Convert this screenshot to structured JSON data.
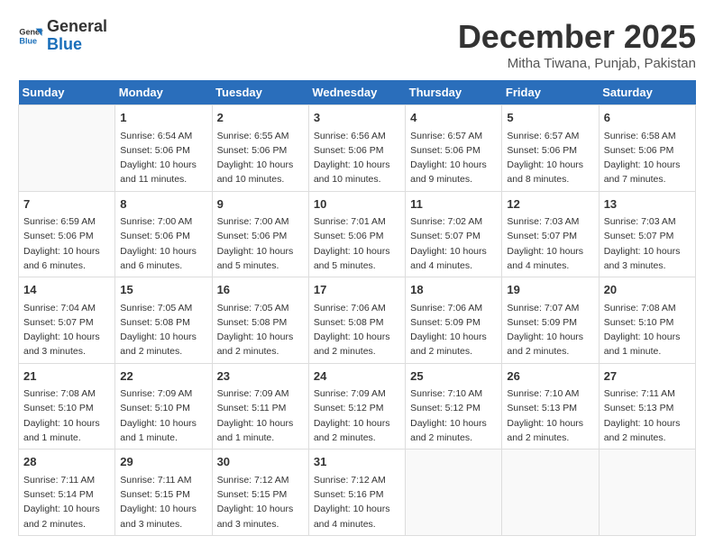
{
  "logo": {
    "line1": "General",
    "line2": "Blue"
  },
  "title": "December 2025",
  "location": "Mitha Tiwana, Punjab, Pakistan",
  "weekdays": [
    "Sunday",
    "Monday",
    "Tuesday",
    "Wednesday",
    "Thursday",
    "Friday",
    "Saturday"
  ],
  "weeks": [
    [
      {
        "num": "",
        "info": ""
      },
      {
        "num": "1",
        "info": "Sunrise: 6:54 AM\nSunset: 5:06 PM\nDaylight: 10 hours\nand 11 minutes."
      },
      {
        "num": "2",
        "info": "Sunrise: 6:55 AM\nSunset: 5:06 PM\nDaylight: 10 hours\nand 10 minutes."
      },
      {
        "num": "3",
        "info": "Sunrise: 6:56 AM\nSunset: 5:06 PM\nDaylight: 10 hours\nand 10 minutes."
      },
      {
        "num": "4",
        "info": "Sunrise: 6:57 AM\nSunset: 5:06 PM\nDaylight: 10 hours\nand 9 minutes."
      },
      {
        "num": "5",
        "info": "Sunrise: 6:57 AM\nSunset: 5:06 PM\nDaylight: 10 hours\nand 8 minutes."
      },
      {
        "num": "6",
        "info": "Sunrise: 6:58 AM\nSunset: 5:06 PM\nDaylight: 10 hours\nand 7 minutes."
      }
    ],
    [
      {
        "num": "7",
        "info": "Sunrise: 6:59 AM\nSunset: 5:06 PM\nDaylight: 10 hours\nand 6 minutes."
      },
      {
        "num": "8",
        "info": "Sunrise: 7:00 AM\nSunset: 5:06 PM\nDaylight: 10 hours\nand 6 minutes."
      },
      {
        "num": "9",
        "info": "Sunrise: 7:00 AM\nSunset: 5:06 PM\nDaylight: 10 hours\nand 5 minutes."
      },
      {
        "num": "10",
        "info": "Sunrise: 7:01 AM\nSunset: 5:06 PM\nDaylight: 10 hours\nand 5 minutes."
      },
      {
        "num": "11",
        "info": "Sunrise: 7:02 AM\nSunset: 5:07 PM\nDaylight: 10 hours\nand 4 minutes."
      },
      {
        "num": "12",
        "info": "Sunrise: 7:03 AM\nSunset: 5:07 PM\nDaylight: 10 hours\nand 4 minutes."
      },
      {
        "num": "13",
        "info": "Sunrise: 7:03 AM\nSunset: 5:07 PM\nDaylight: 10 hours\nand 3 minutes."
      }
    ],
    [
      {
        "num": "14",
        "info": "Sunrise: 7:04 AM\nSunset: 5:07 PM\nDaylight: 10 hours\nand 3 minutes."
      },
      {
        "num": "15",
        "info": "Sunrise: 7:05 AM\nSunset: 5:08 PM\nDaylight: 10 hours\nand 2 minutes."
      },
      {
        "num": "16",
        "info": "Sunrise: 7:05 AM\nSunset: 5:08 PM\nDaylight: 10 hours\nand 2 minutes."
      },
      {
        "num": "17",
        "info": "Sunrise: 7:06 AM\nSunset: 5:08 PM\nDaylight: 10 hours\nand 2 minutes."
      },
      {
        "num": "18",
        "info": "Sunrise: 7:06 AM\nSunset: 5:09 PM\nDaylight: 10 hours\nand 2 minutes."
      },
      {
        "num": "19",
        "info": "Sunrise: 7:07 AM\nSunset: 5:09 PM\nDaylight: 10 hours\nand 2 minutes."
      },
      {
        "num": "20",
        "info": "Sunrise: 7:08 AM\nSunset: 5:10 PM\nDaylight: 10 hours\nand 1 minute."
      }
    ],
    [
      {
        "num": "21",
        "info": "Sunrise: 7:08 AM\nSunset: 5:10 PM\nDaylight: 10 hours\nand 1 minute."
      },
      {
        "num": "22",
        "info": "Sunrise: 7:09 AM\nSunset: 5:10 PM\nDaylight: 10 hours\nand 1 minute."
      },
      {
        "num": "23",
        "info": "Sunrise: 7:09 AM\nSunset: 5:11 PM\nDaylight: 10 hours\nand 1 minute."
      },
      {
        "num": "24",
        "info": "Sunrise: 7:09 AM\nSunset: 5:12 PM\nDaylight: 10 hours\nand 2 minutes."
      },
      {
        "num": "25",
        "info": "Sunrise: 7:10 AM\nSunset: 5:12 PM\nDaylight: 10 hours\nand 2 minutes."
      },
      {
        "num": "26",
        "info": "Sunrise: 7:10 AM\nSunset: 5:13 PM\nDaylight: 10 hours\nand 2 minutes."
      },
      {
        "num": "27",
        "info": "Sunrise: 7:11 AM\nSunset: 5:13 PM\nDaylight: 10 hours\nand 2 minutes."
      }
    ],
    [
      {
        "num": "28",
        "info": "Sunrise: 7:11 AM\nSunset: 5:14 PM\nDaylight: 10 hours\nand 2 minutes."
      },
      {
        "num": "29",
        "info": "Sunrise: 7:11 AM\nSunset: 5:15 PM\nDaylight: 10 hours\nand 3 minutes."
      },
      {
        "num": "30",
        "info": "Sunrise: 7:12 AM\nSunset: 5:15 PM\nDaylight: 10 hours\nand 3 minutes."
      },
      {
        "num": "31",
        "info": "Sunrise: 7:12 AM\nSunset: 5:16 PM\nDaylight: 10 hours\nand 4 minutes."
      },
      {
        "num": "",
        "info": ""
      },
      {
        "num": "",
        "info": ""
      },
      {
        "num": "",
        "info": ""
      }
    ]
  ]
}
